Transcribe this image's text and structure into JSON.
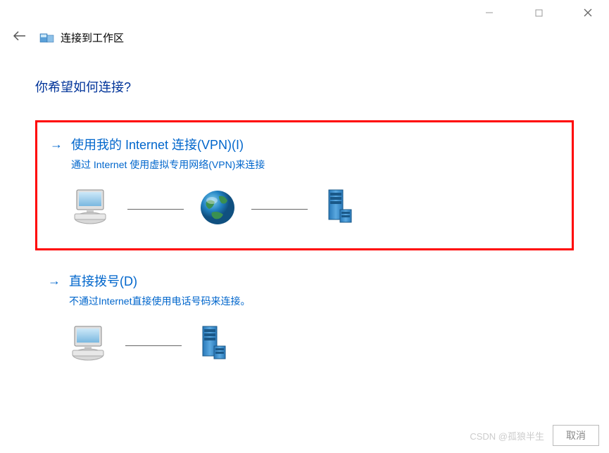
{
  "window": {
    "title": "连接到工作区"
  },
  "heading": "你希望如何连接?",
  "options": {
    "vpn": {
      "title": "使用我的 Internet 连接(VPN)(I)",
      "desc": "通过 Internet 使用虚拟专用网络(VPN)来连接"
    },
    "dial": {
      "title": "直接拨号(D)",
      "desc": "不通过Internet直接使用电话号码来连接。"
    }
  },
  "buttons": {
    "cancel": "取消"
  },
  "watermark": "CSDN @孤狼半生"
}
